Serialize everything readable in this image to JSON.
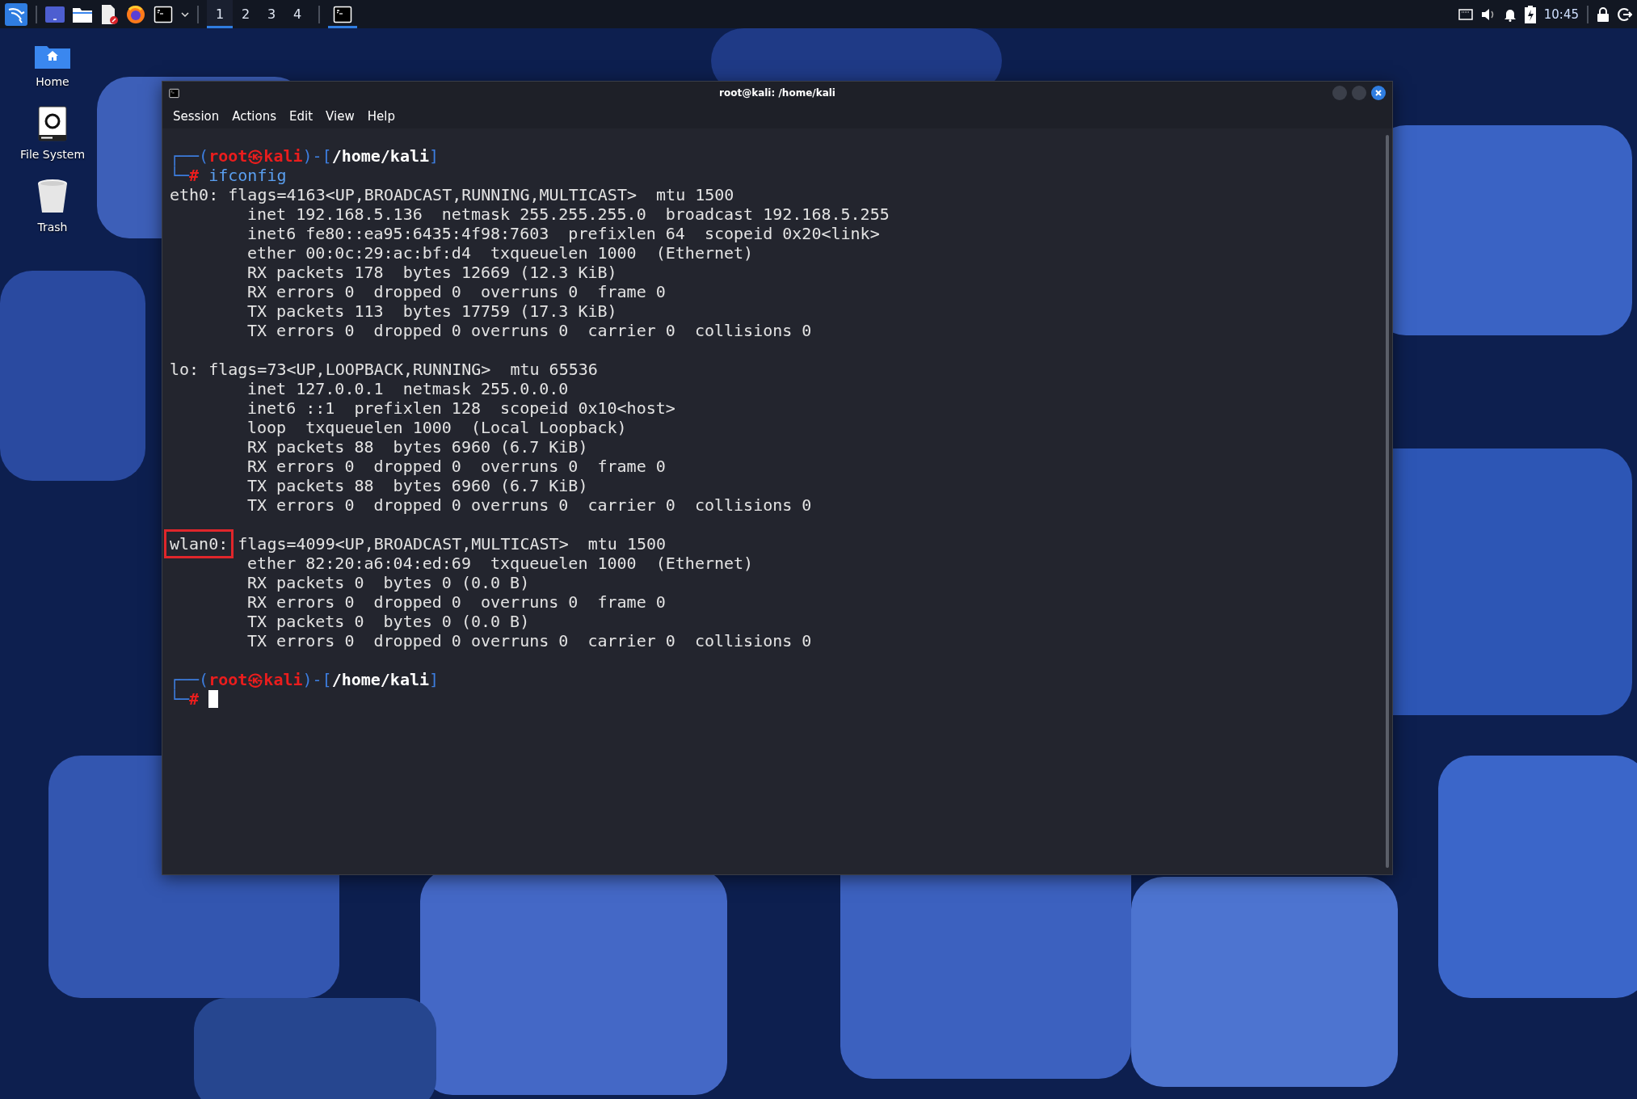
{
  "taskbar": {
    "workspaces": [
      {
        "label": "1",
        "selected": true
      },
      {
        "label": "2",
        "selected": false
      },
      {
        "label": "3",
        "selected": false
      },
      {
        "label": "4",
        "selected": false
      }
    ],
    "tasks": [
      {
        "kind": "terminal",
        "selected": true
      }
    ],
    "clock": "10:45"
  },
  "desktop_icons": [
    {
      "kind": "home",
      "label": "Home"
    },
    {
      "kind": "drive",
      "label": "File System"
    },
    {
      "kind": "trash",
      "label": "Trash"
    }
  ],
  "window": {
    "title": "root@kali: /home/kali",
    "menu": [
      "Session",
      "Actions",
      "Edit",
      "View",
      "Help"
    ],
    "prompt_before": {
      "lines": [
        [
          {
            "kind": "frame",
            "text": "┌──("
          },
          {
            "kind": "user",
            "text": "root㉿kali"
          },
          {
            "kind": "frame",
            "text": ")-["
          },
          {
            "kind": "path",
            "text": "/home/kali"
          },
          {
            "kind": "frame",
            "text": "]"
          }
        ],
        [
          {
            "kind": "frame",
            "text": "└─"
          },
          {
            "kind": "user",
            "text": "#"
          },
          {
            "kind": "command",
            "text": " ifconfig"
          }
        ]
      ]
    },
    "interfaces": [
      {
        "name": "eth0:",
        "highlighted": false,
        "header": " flags=4163<UP,BROADCAST,RUNNING,MULTICAST>  mtu 1500",
        "lines": [
          "inet 192.168.5.136  netmask 255.255.255.0  broadcast 192.168.5.255",
          "inet6 fe80::ea95:6435:4f98:7603  prefixlen 64  scopeid 0x20<link>",
          "ether 00:0c:29:ac:bf:d4  txqueuelen 1000  (Ethernet)",
          "RX packets 178  bytes 12669 (12.3 KiB)",
          "RX errors 0  dropped 0  overruns 0  frame 0",
          "TX packets 113  bytes 17759 (17.3 KiB)",
          "TX errors 0  dropped 0 overruns 0  carrier 0  collisions 0"
        ]
      },
      {
        "name": "lo:",
        "highlighted": false,
        "header": " flags=73<UP,LOOPBACK,RUNNING>  mtu 65536",
        "lines": [
          "inet 127.0.0.1  netmask 255.0.0.0",
          "inet6 ::1  prefixlen 128  scopeid 0x10<host>",
          "loop  txqueuelen 1000  (Local Loopback)",
          "RX packets 88  bytes 6960 (6.7 KiB)",
          "RX errors 0  dropped 0  overruns 0  frame 0",
          "TX packets 88  bytes 6960 (6.7 KiB)",
          "TX errors 0  dropped 0 overruns 0  carrier 0  collisions 0"
        ]
      },
      {
        "name": "wlan0:",
        "highlighted": true,
        "header": " flags=4099<UP,BROADCAST,MULTICAST>  mtu 1500",
        "lines": [
          "ether 82:20:a6:04:ed:69  txqueuelen 1000  (Ethernet)",
          "RX packets 0  bytes 0 (0.0 B)",
          "RX errors 0  dropped 0  overruns 0  frame 0",
          "TX packets 0  bytes 0 (0.0 B)",
          "TX errors 0  dropped 0 overruns 0  carrier 0  collisions 0"
        ]
      }
    ],
    "prompt_after": {
      "lines": [
        [
          {
            "kind": "frame",
            "text": "┌──("
          },
          {
            "kind": "user",
            "text": "root㉿kali"
          },
          {
            "kind": "frame",
            "text": ")-["
          },
          {
            "kind": "path",
            "text": "/home/kali"
          },
          {
            "kind": "frame",
            "text": "]"
          }
        ],
        [
          {
            "kind": "frame",
            "text": "└─"
          },
          {
            "kind": "user",
            "text": "#"
          }
        ]
      ]
    }
  }
}
